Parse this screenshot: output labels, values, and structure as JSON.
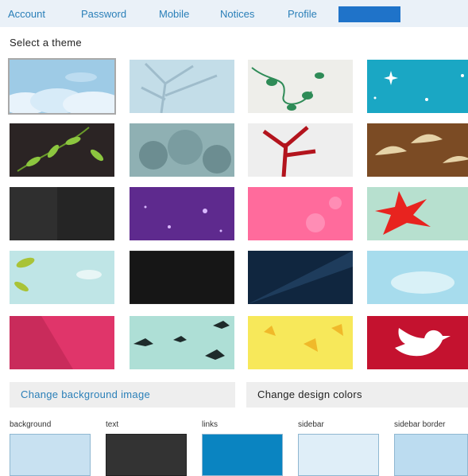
{
  "tabs": [
    {
      "label": "Account"
    },
    {
      "label": "Password"
    },
    {
      "label": "Mobile"
    },
    {
      "label": "Notices"
    },
    {
      "label": "Profile"
    },
    {
      "label": ""
    }
  ],
  "themes": {
    "title": "Select a theme",
    "selected_index": 0,
    "items": [
      {
        "name": "sky-clouds-theme",
        "colors": [
          "#9ecbe6",
          "#e8f3fb"
        ]
      },
      {
        "name": "winter-tree-theme",
        "colors": [
          "#c3dde8",
          "#9fbccb"
        ]
      },
      {
        "name": "green-vine-theme",
        "colors": [
          "#eeeeea",
          "#2e8b57"
        ]
      },
      {
        "name": "aqua-stars-theme",
        "colors": [
          "#1aa7c4",
          "#ffffff"
        ]
      },
      {
        "name": "leaves-on-dark-theme",
        "colors": [
          "#2b2424",
          "#8cc63f"
        ]
      },
      {
        "name": "teal-foliage-theme",
        "colors": [
          "#8fb0b3",
          "#6c8d91"
        ]
      },
      {
        "name": "red-plant-theme",
        "colors": [
          "#eeeeee",
          "#b3141d"
        ]
      },
      {
        "name": "brown-birds-theme",
        "colors": [
          "#7b4b24",
          "#e6d3a8"
        ]
      },
      {
        "name": "dark-grunge-theme",
        "colors": [
          "#2f2f2f",
          "#1f1f1f"
        ]
      },
      {
        "name": "purple-sparkle-theme",
        "colors": [
          "#5e2a8e",
          "#d9b8ff"
        ]
      },
      {
        "name": "pink-flowers-theme",
        "colors": [
          "#ff6b9c",
          "#ff8db5"
        ]
      },
      {
        "name": "red-maple-theme",
        "colors": [
          "#b7e0cf",
          "#e8231f"
        ]
      },
      {
        "name": "light-cloud-leaves-theme",
        "colors": [
          "#bfe5e6",
          "#a9c337"
        ]
      },
      {
        "name": "black-hex-theme",
        "colors": [
          "#161616",
          "#2c2c2c"
        ]
      },
      {
        "name": "navy-rays-theme",
        "colors": [
          "#10263f",
          "#1e3c5c"
        ]
      },
      {
        "name": "sky-blue-clouds-theme",
        "colors": [
          "#a7dced",
          "#d9f1f7"
        ]
      },
      {
        "name": "crimson-diagonal-theme",
        "colors": [
          "#c92b5b",
          "#e0356a"
        ]
      },
      {
        "name": "birds-on-mint-theme",
        "colors": [
          "#aedfd6",
          "#1e2b2b"
        ]
      },
      {
        "name": "yellow-leaves-theme",
        "colors": [
          "#f7e85a",
          "#f0b92a"
        ]
      },
      {
        "name": "twitter-bird-theme",
        "colors": [
          "#c4122f",
          "#ffffff"
        ]
      }
    ]
  },
  "actions": {
    "change_background": "Change background image",
    "change_colors": "Change design colors"
  },
  "design_colors": [
    {
      "label": "background",
      "color": "#c8e1f1"
    },
    {
      "label": "text",
      "color": "#333333"
    },
    {
      "label": "links",
      "color": "#0a84c1"
    },
    {
      "label": "sidebar",
      "color": "#dfeef8"
    },
    {
      "label": "sidebar border",
      "color": "#bcdcf0"
    }
  ]
}
